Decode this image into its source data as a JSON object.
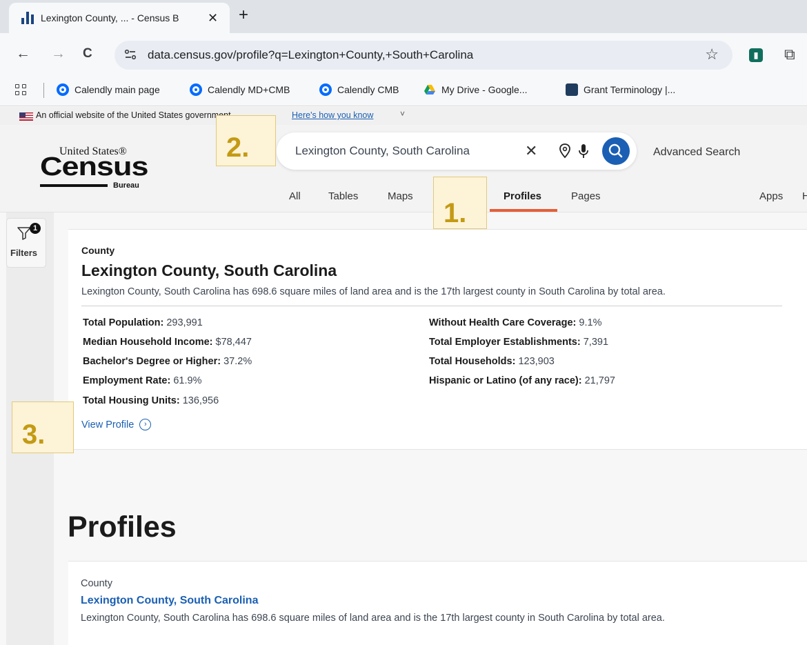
{
  "browser": {
    "tab_title": "Lexington County, ... - Census B",
    "tab_close": "✕",
    "new_tab": "+",
    "back": "←",
    "forward": "→",
    "reload": "C",
    "url": "data.census.gov/profile?q=Lexington+County,+South+Carolina",
    "star": "☆",
    "bookmarks": [
      {
        "label": "Calendly main page",
        "icon": "calendly-icon"
      },
      {
        "label": "Calendly MD+CMB",
        "icon": "calendly-icon"
      },
      {
        "label": "Calendly CMB",
        "icon": "calendly-icon"
      },
      {
        "label": "My Drive - Google...",
        "icon": "google-drive-icon"
      },
      {
        "label": "Grant Terminology |...",
        "icon": "grant-icon"
      }
    ],
    "colors": {
      "tab_bar": "#dfe3e8",
      "toolbar": "#f7f8fa"
    }
  },
  "gov_banner": {
    "text": "An official website of the United States government",
    "link": "Here's how you know",
    "chevron": "˅"
  },
  "header": {
    "logo_top": "United States®",
    "logo_main": "Census",
    "logo_bottom": "Bureau",
    "search_value": "Lexington County, South Carolina",
    "clear_icon": "✕",
    "advanced_search": "Advanced Search",
    "tabs": [
      "All",
      "Tables",
      "Maps",
      "Profiles",
      "Pages",
      "Apps",
      "H"
    ],
    "active_tab": "Profiles",
    "accent_color": "#e35f38",
    "search_button_color": "#1a5fb4"
  },
  "sidebar": {
    "filter_label": "Filters",
    "filter_count": "1"
  },
  "card": {
    "type": "County",
    "title": "Lexington County, South Carolina",
    "description": "Lexington County, South Carolina has 698.6 square miles of land area and is the 17th largest county in South Carolina by total area.",
    "stats_left": [
      {
        "label": "Total Population:",
        "value": "293,991"
      },
      {
        "label": "Median Household Income:",
        "value": "$78,447"
      },
      {
        "label": "Bachelor's Degree or Higher:",
        "value": "37.2%"
      },
      {
        "label": "Employment Rate:",
        "value": "61.9%"
      },
      {
        "label": "Total Housing Units:",
        "value": "136,956"
      }
    ],
    "stats_right": [
      {
        "label": "Without Health Care Coverage:",
        "value": "9.1%"
      },
      {
        "label": "Total Employer Establishments:",
        "value": "7,391"
      },
      {
        "label": "Total Households:",
        "value": "123,903"
      },
      {
        "label": "Hispanic or Latino (of any race):",
        "value": "21,797"
      }
    ],
    "view_profile": "View Profile",
    "view_profile_icon": "›"
  },
  "profiles_section": {
    "heading": "Profiles",
    "item_type": "County",
    "item_title": "Lexington County, South Carolina",
    "item_description": "Lexington County, South Carolina has 698.6 square miles of land area and is the 17th largest county in South Carolina by total area."
  },
  "callouts": {
    "one": "1.",
    "two": "2.",
    "three": "3.",
    "color": "#c39a14"
  }
}
